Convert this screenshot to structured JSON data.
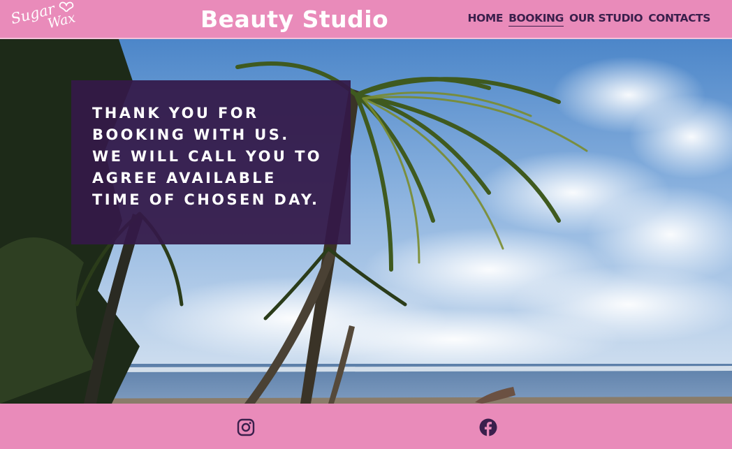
{
  "header": {
    "logo_text_line1": "Sugar",
    "logo_text_line2": "Wax",
    "brand": "Beauty Studio",
    "nav": [
      {
        "label": "HOME",
        "active": false
      },
      {
        "label": "BOOKING",
        "active": true
      },
      {
        "label": "OUR STUDIO",
        "active": false
      },
      {
        "label": "CONTACTS",
        "active": false
      }
    ]
  },
  "hero": {
    "message_lines": [
      "Thank you for",
      "booking with us.",
      "We will call you to",
      "agree available",
      "time of chosen day."
    ]
  },
  "footer": {
    "social": [
      {
        "icon": "instagram-icon"
      },
      {
        "icon": "facebook-icon"
      }
    ]
  },
  "colors": {
    "brand_pink": "#e98bba",
    "nav_text": "#3a1f4c",
    "message_bg": "#341948",
    "white": "#ffffff"
  }
}
